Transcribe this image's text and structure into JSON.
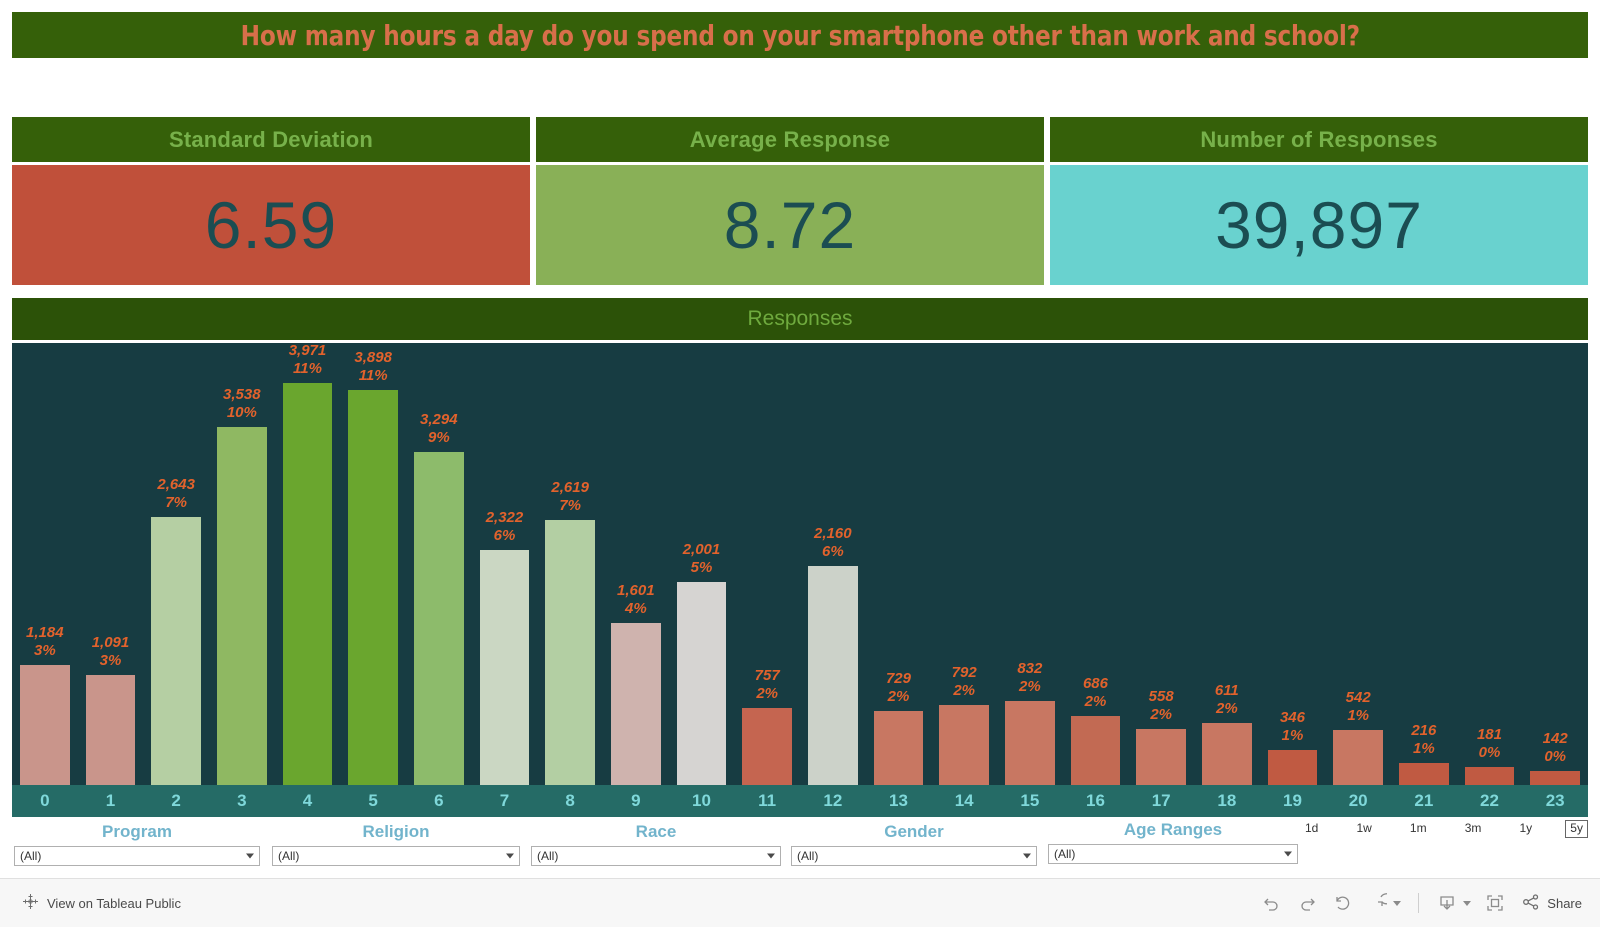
{
  "title": "How many hours a day do you spend on your smartphone other than work and school?",
  "colors": {
    "banner_green": "#356009",
    "header_green": "#2c5208",
    "header_text_green": "#77b14a",
    "title_salmon": "#d86f4a",
    "plot_background": "#173c42",
    "axis_band_teal": "#256b66",
    "axis_text": "#7fd8da",
    "label_orange": "#e2622c",
    "kpi_value_text": "#1b4d52",
    "filter_label_blue": "#72b4cc"
  },
  "kpis": [
    {
      "label": "Standard Deviation",
      "value": "6.59",
      "color": "#c0503a"
    },
    {
      "label": "Average Response",
      "value": "8.72",
      "color": "#89b057"
    },
    {
      "label": "Number of Responses",
      "value": "39,897",
      "color": "#69d2cf"
    }
  ],
  "chart_panel_title": "Responses",
  "chart_data": {
    "type": "bar",
    "title": "Responses",
    "xlabel": "",
    "ylabel": "",
    "grid": false,
    "legend": "none",
    "ylim": [
      0,
      3971
    ],
    "categories": [
      "0",
      "1",
      "2",
      "3",
      "4",
      "5",
      "6",
      "7",
      "8",
      "9",
      "10",
      "11",
      "12",
      "13",
      "14",
      "15",
      "16",
      "17",
      "18",
      "19",
      "20",
      "21",
      "22",
      "23"
    ],
    "values": [
      1184,
      1091,
      2643,
      3538,
      3971,
      3898,
      3294,
      2322,
      2619,
      1601,
      2001,
      757,
      2160,
      729,
      792,
      832,
      686,
      558,
      611,
      346,
      542,
      216,
      181,
      142
    ],
    "value_labels": [
      "1,184",
      "1,091",
      "2,643",
      "3,538",
      "3,971",
      "3,898",
      "3,294",
      "2,322",
      "2,619",
      "1,601",
      "2,001",
      "757",
      "2,160",
      "729",
      "792",
      "832",
      "686",
      "558",
      "611",
      "346",
      "542",
      "216",
      "181",
      "142"
    ],
    "percent_labels": [
      "3%",
      "3%",
      "7%",
      "10%",
      "11%",
      "11%",
      "9%",
      "6%",
      "7%",
      "4%",
      "5%",
      "2%",
      "6%",
      "2%",
      "2%",
      "2%",
      "2%",
      "2%",
      "2%",
      "1%",
      "1%",
      "1%",
      "0%",
      "0%"
    ],
    "bar_colors": [
      "#c9958b",
      "#c9958b",
      "#b5cfa3",
      "#8fb862",
      "#6aa62e",
      "#6aa62e",
      "#8dbb6b",
      "#cbd7c3",
      "#b3cfa3",
      "#cfb3ae",
      "#d6d4d2",
      "#c56550",
      "#ccd2c9",
      "#c87762",
      "#c87762",
      "#c87762",
      "#c26a53",
      "#c87762",
      "#c87762",
      "#c05a42",
      "#c87762",
      "#c05a42",
      "#c05a42",
      "#c05a42"
    ]
  },
  "filters": [
    {
      "label": "Program",
      "value": "(All)"
    },
    {
      "label": "Religion",
      "value": "(All)"
    },
    {
      "label": "Race",
      "value": "(All)"
    },
    {
      "label": "Gender",
      "value": "(All)"
    },
    {
      "label": "Age Ranges",
      "value": "(All)"
    }
  ],
  "time_range": {
    "options": [
      "1d",
      "1w",
      "1m",
      "3m",
      "1y",
      "5y"
    ],
    "selected": "5y"
  },
  "bottom_bar": {
    "view_link": "View on Tableau Public",
    "share_label": "Share",
    "icons": [
      "undo-icon",
      "redo-icon",
      "revert-icon",
      "refresh-icon",
      "download-icon",
      "fullscreen-icon",
      "share-icon"
    ]
  }
}
